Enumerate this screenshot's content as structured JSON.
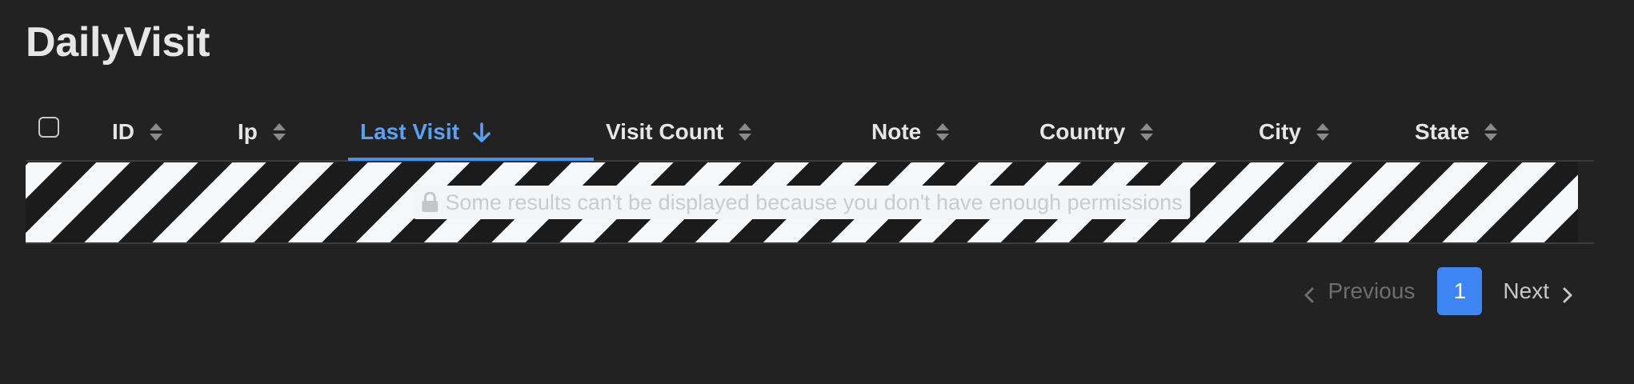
{
  "page": {
    "title": "DailyVisit"
  },
  "table": {
    "columns": [
      {
        "label": "ID",
        "sort": "none"
      },
      {
        "label": "Ip",
        "sort": "none"
      },
      {
        "label": "Last Visit",
        "sort": "desc"
      },
      {
        "label": "Visit Count",
        "sort": "none"
      },
      {
        "label": "Note",
        "sort": "none"
      },
      {
        "label": "Country",
        "sort": "none"
      },
      {
        "label": "City",
        "sort": "none"
      },
      {
        "label": "State",
        "sort": "none"
      }
    ],
    "notice": {
      "icon": "lock-icon",
      "text": "Some results can't be displayed because you don't have enough permissions"
    }
  },
  "pagination": {
    "previous_label": "Previous",
    "current_page": "1",
    "next_label": "Next"
  },
  "colors": {
    "background": "#222222",
    "accent": "#3d85f2",
    "active_sort": "#5aa1f5",
    "stripe_dark": "#1b1b1b",
    "stripe_light": "#f7f8fa"
  }
}
